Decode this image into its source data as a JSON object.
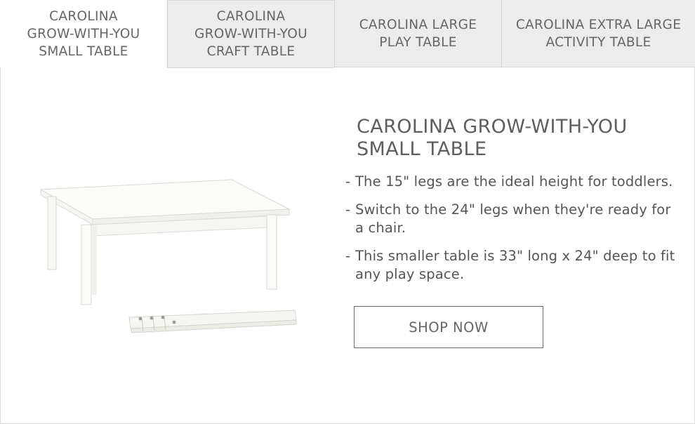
{
  "tabs": [
    {
      "label": "CAROLINA\nGROW-WITH-YOU\nSMALL TABLE",
      "active": true
    },
    {
      "label": "CAROLINA\nGROW-WITH-YOU\nCRAFT TABLE",
      "active": false
    },
    {
      "label": "CAROLINA LARGE\nPLAY TABLE",
      "active": false
    },
    {
      "label": "CAROLINA EXTRA LARGE\nACTIVITY TABLE",
      "active": false
    }
  ],
  "product": {
    "title": "CAROLINA GROW-WITH-YOU\nSMALL TABLE",
    "bullet_prefix": "-",
    "bullets": [
      "The 15\" legs are the ideal height for toddlers.",
      "Switch to the 24\" legs when they're ready for a chair.",
      "This smaller table is 33\" long x 24\" deep to fit any play space."
    ],
    "shop_label": "SHOP NOW"
  },
  "colors": {
    "tab_inactive_bg": "#ececec",
    "text": "#555555",
    "border": "#d4d4d4"
  }
}
